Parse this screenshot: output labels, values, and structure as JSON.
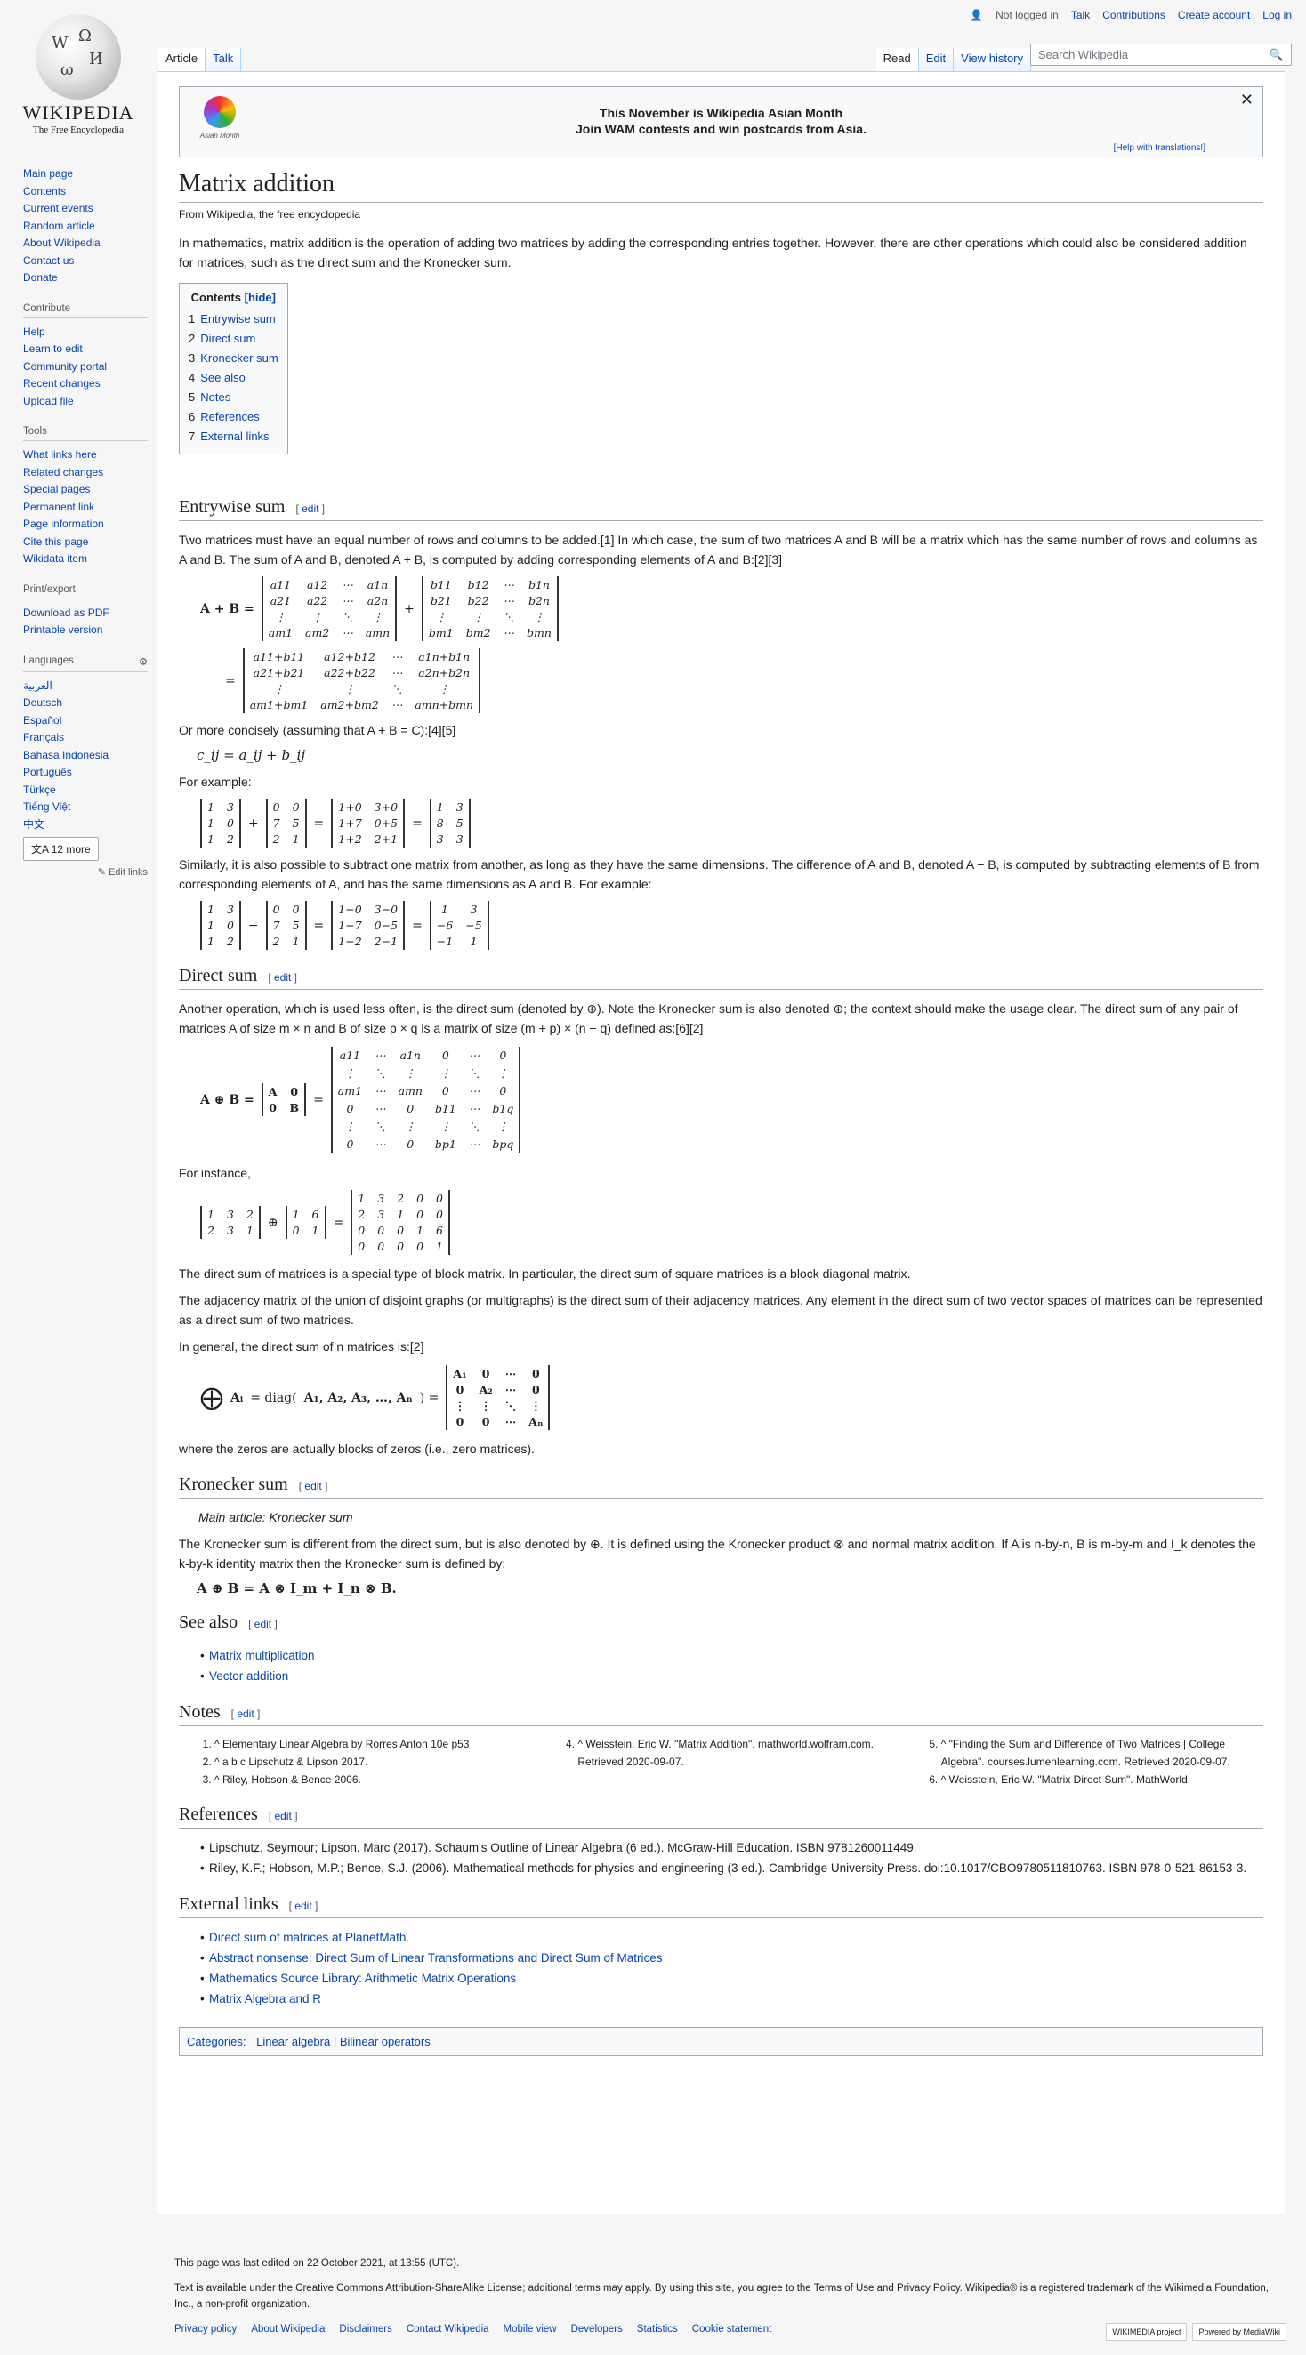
{
  "personal": {
    "not_logged": "Not logged in",
    "talk": "Talk",
    "contributions": "Contributions",
    "create": "Create account",
    "login": "Log in"
  },
  "logo": {
    "wordmark": "WIKIPEDIA",
    "tagline": "The Free Encyclopedia"
  },
  "nav": [
    "Main page",
    "Contents",
    "Current events",
    "Random article",
    "About Wikipedia",
    "Contact us",
    "Donate"
  ],
  "contribute": {
    "title": "Contribute",
    "items": [
      "Help",
      "Learn to edit",
      "Community portal",
      "Recent changes",
      "Upload file"
    ]
  },
  "tools": {
    "title": "Tools",
    "items": [
      "What links here",
      "Related changes",
      "Special pages",
      "Permanent link",
      "Page information",
      "Cite this page",
      "Wikidata item"
    ]
  },
  "print": {
    "title": "Print/export",
    "items": [
      "Download as PDF",
      "Printable version"
    ]
  },
  "languages": {
    "title": "Languages",
    "items": [
      "العربية",
      "Deutsch",
      "Español",
      "Français",
      "Bahasa Indonesia",
      "Português",
      "Türkçe",
      "Tiếng Việt",
      "中文"
    ],
    "more": "12 more",
    "edit": "Edit links"
  },
  "tabs": {
    "article": "Article",
    "talk": "Talk",
    "read": "Read",
    "edit": "Edit",
    "history": "View history"
  },
  "search": {
    "placeholder": "Search Wikipedia"
  },
  "banner": {
    "line1": "This November is Wikipedia Asian Month",
    "line2": "Join WAM contests and win postcards from Asia.",
    "help": "[Help with translations!]",
    "logo_text": "Asian Month"
  },
  "title": "Matrix addition",
  "from": "From Wikipedia, the free encyclopedia",
  "intro": "In mathematics, matrix addition is the operation of adding two matrices by adding the corresponding entries together. However, there are other operations which could also be considered addition for matrices, such as the direct sum and the Kronecker sum.",
  "toc": {
    "title": "Contents",
    "hide": "[hide]",
    "items": [
      "Entrywise sum",
      "Direct sum",
      "Kronecker sum",
      "See also",
      "Notes",
      "References",
      "External links"
    ]
  },
  "edit_label": "edit",
  "entrywise": {
    "heading": "Entrywise sum",
    "p1": "Two matrices must have an equal number of rows and columns to be added.[1] In which case, the sum of two matrices A and B will be a matrix which has the same number of rows and columns as A and B. The sum of A and B, denoted A + B, is computed by adding corresponding elements of A and B:[2][3]",
    "p2": "Or more concisely (assuming that A + B = C):[4][5]",
    "formula": "c_ij = a_ij + b_ij",
    "p3": "For example:",
    "p4": "Similarly, it is also possible to subtract one matrix from another, as long as they have the same dimensions. The difference of A and B, denoted A − B, is computed by subtracting elements of B from corresponding elements of A, and has the same dimensions as A and B. For example:"
  },
  "direct": {
    "heading": "Direct sum",
    "p1": "Another operation, which is used less often, is the direct sum (denoted by ⊕). Note the Kronecker sum is also denoted ⊕; the context should make the usage clear. The direct sum of any pair of matrices A of size m × n and B of size p × q is a matrix of size (m + p) × (n + q) defined as:[6][2]",
    "p2": "For instance,",
    "p3": "The direct sum of matrices is a special type of block matrix. In particular, the direct sum of square matrices is a block diagonal matrix.",
    "p4": "The adjacency matrix of the union of disjoint graphs (or multigraphs) is the direct sum of their adjacency matrices. Any element in the direct sum of two vector spaces of matrices can be represented as a direct sum of two matrices.",
    "p5": "In general, the direct sum of n matrices is:[2]",
    "p6": "where the zeros are actually blocks of zeros (i.e., zero matrices)."
  },
  "kronecker": {
    "heading": "Kronecker sum",
    "main": "Main article: Kronecker sum",
    "p1": "The Kronecker sum is different from the direct sum, but is also denoted by ⊕. It is defined using the Kronecker product ⊗ and normal matrix addition. If A is n-by-n, B is m-by-m and I_k denotes the k-by-k identity matrix then the Kronecker sum is defined by:",
    "formula": "A ⊕ B = A ⊗ I_m + I_n ⊗ B."
  },
  "seealso": {
    "heading": "See also",
    "items": [
      "Matrix multiplication",
      "Vector addition"
    ]
  },
  "notes": {
    "heading": "Notes",
    "col1": [
      "^ Elementary Linear Algebra by Rorres Anton 10e p53",
      "^ a b c Lipschutz & Lipson 2017.",
      "^ Riley, Hobson & Bence 2006."
    ],
    "col2": [
      "^ Weisstein, Eric W. \"Matrix Addition\". mathworld.wolfram.com. Retrieved 2020-09-07."
    ],
    "col3": [
      "^ \"Finding the Sum and Difference of Two Matrices | College Algebra\". courses.lumenlearning.com. Retrieved 2020-09-07.",
      "^ Weisstein, Eric W. \"Matrix Direct Sum\". MathWorld."
    ]
  },
  "references": {
    "heading": "References",
    "items": [
      "Lipschutz, Seymour; Lipson, Marc (2017). Schaum's Outline of Linear Algebra (6 ed.). McGraw-Hill Education. ISBN 9781260011449.",
      "Riley, K.F.; Hobson, M.P.; Bence, S.J. (2006). Mathematical methods for physics and engineering (3 ed.). Cambridge University Press. doi:10.1017/CBO9780511810763. ISBN 978-0-521-86153-3."
    ]
  },
  "external": {
    "heading": "External links",
    "items": [
      "Direct sum of matrices at PlanetMath.",
      "Abstract nonsense: Direct Sum of Linear Transformations and Direct Sum of Matrices",
      "Mathematics Source Library: Arithmetic Matrix Operations",
      "Matrix Algebra and R"
    ]
  },
  "categories": {
    "label": "Categories:",
    "items": [
      "Linear algebra",
      "Bilinear operators"
    ]
  },
  "footer": {
    "edited": "This page was last edited on 22 October 2021, at 13:55 (UTC).",
    "license": "Text is available under the Creative Commons Attribution-ShareAlike License; additional terms may apply. By using this site, you agree to the Terms of Use and Privacy Policy. Wikipedia® is a registered trademark of the Wikimedia Foundation, Inc., a non-profit organization.",
    "links": [
      "Privacy policy",
      "About Wikipedia",
      "Disclaimers",
      "Contact Wikipedia",
      "Mobile view",
      "Developers",
      "Statistics",
      "Cookie statement"
    ],
    "badge1": "WIKIMEDIA project",
    "badge2": "Powered by MediaWiki"
  }
}
